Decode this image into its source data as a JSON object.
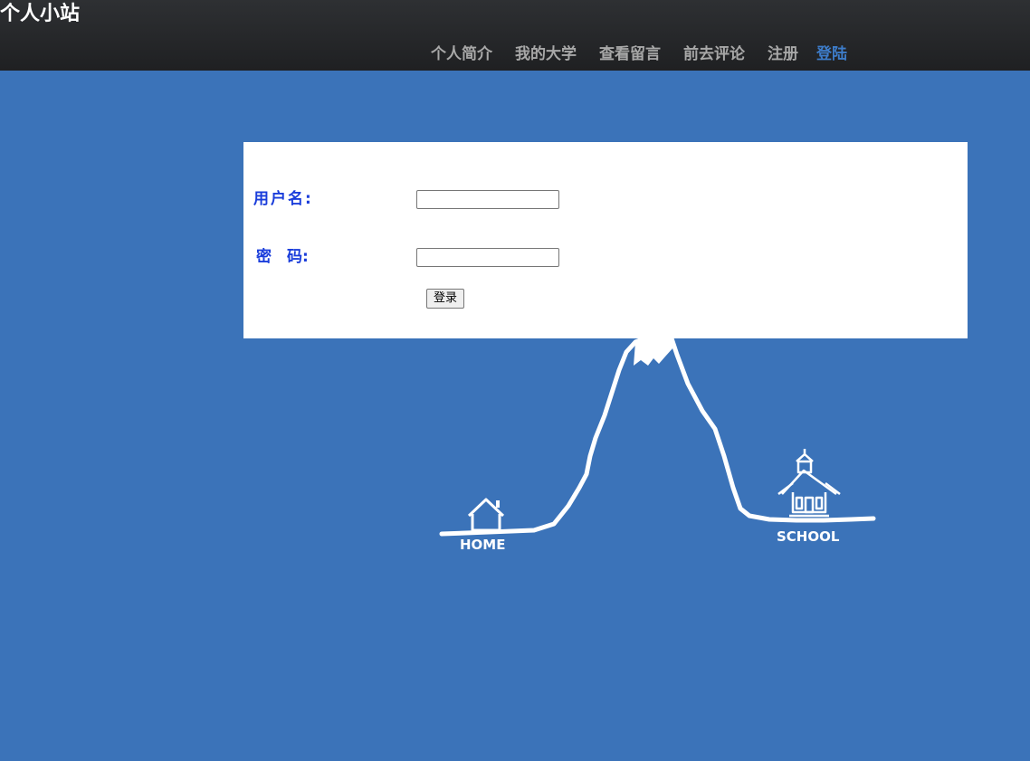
{
  "header": {
    "site_title": "个人小站",
    "nav": [
      {
        "label": "个人简介",
        "active": false
      },
      {
        "label": "我的大学",
        "active": false
      },
      {
        "label": "查看留言",
        "active": false
      },
      {
        "label": "前去评论",
        "active": false
      },
      {
        "label": "注册",
        "active": false
      },
      {
        "label": "登陆",
        "active": true
      }
    ]
  },
  "login_form": {
    "username_label": "用户名:",
    "password_label": "密　码:",
    "username_value": "",
    "password_value": "",
    "submit_label": "登录"
  },
  "illustration": {
    "home_label": "HOME",
    "school_label": "SCHOOL"
  },
  "colors": {
    "background": "#3b73b9",
    "header": "#262729",
    "nav_text": "#a8a8a8",
    "nav_active": "#3d7cc9",
    "form_label": "#1a3ddb"
  }
}
